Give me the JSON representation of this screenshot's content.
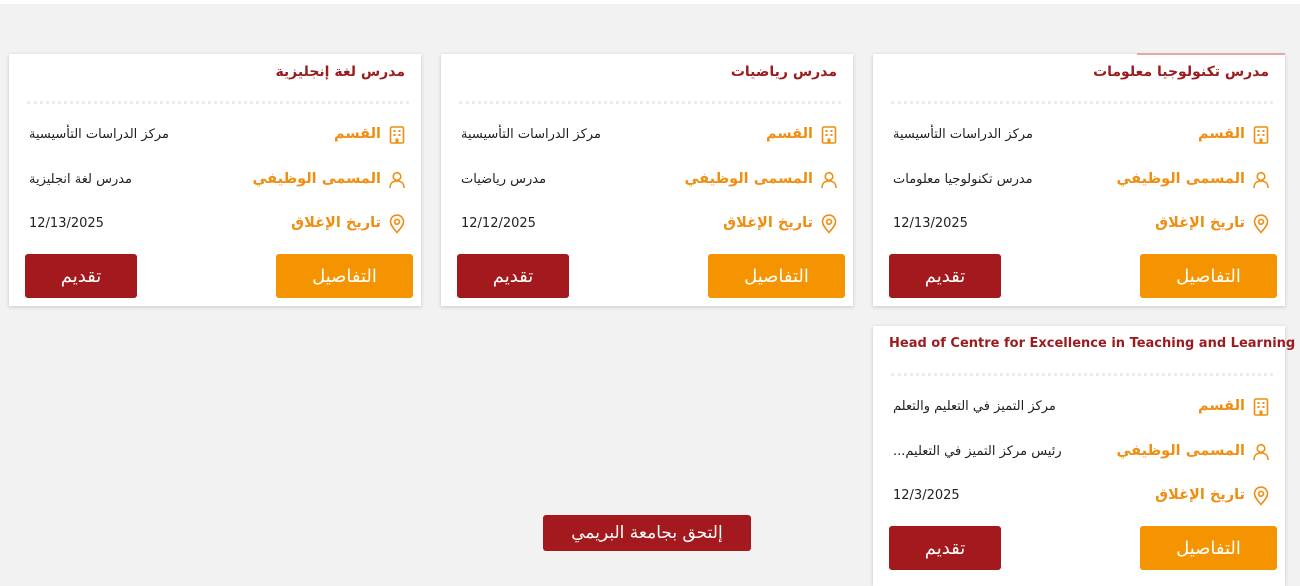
{
  "labels": {
    "department": "القسم",
    "job_title": "المسمى الوظيفي",
    "closing_date": "تاريخ الإغلاق",
    "details_button": "التفاصيل",
    "apply_button": "تقديم"
  },
  "colors": {
    "brand_red": "#a3191d",
    "brand_orange": "#f39400",
    "title_red": "#9b1c1f"
  },
  "icons": {
    "department": "building-icon",
    "job_title": "user-icon",
    "closing_date": "location-pin-icon"
  },
  "jobs": [
    {
      "title": "مدرس تكنولوجيا معلومات",
      "department": "مركز الدراسات التأسيسية",
      "job_title": "مدرس تكنولوجيا معلومات",
      "closing_date": "12/13/2025"
    },
    {
      "title": "مدرس رياضيات",
      "department": "مركز الدراسات التأسيسية",
      "job_title": "مدرس رياضيات",
      "closing_date": "12/12/2025"
    },
    {
      "title": "مدرس لغة إنجليزية",
      "department": "مركز الدراسات التأسيسية",
      "job_title": "مدرس لغة انجليزية",
      "closing_date": "12/13/2025"
    },
    {
      "title": "Head of Centre for Excellence in Teaching and Learning",
      "department": "مركز التميز في التعليم والتعلم",
      "job_title": "رئيس مركز التميز في التعليم...",
      "closing_date": "12/3/2025"
    }
  ],
  "verify_button": "إلتحق بجامعة البريمي"
}
